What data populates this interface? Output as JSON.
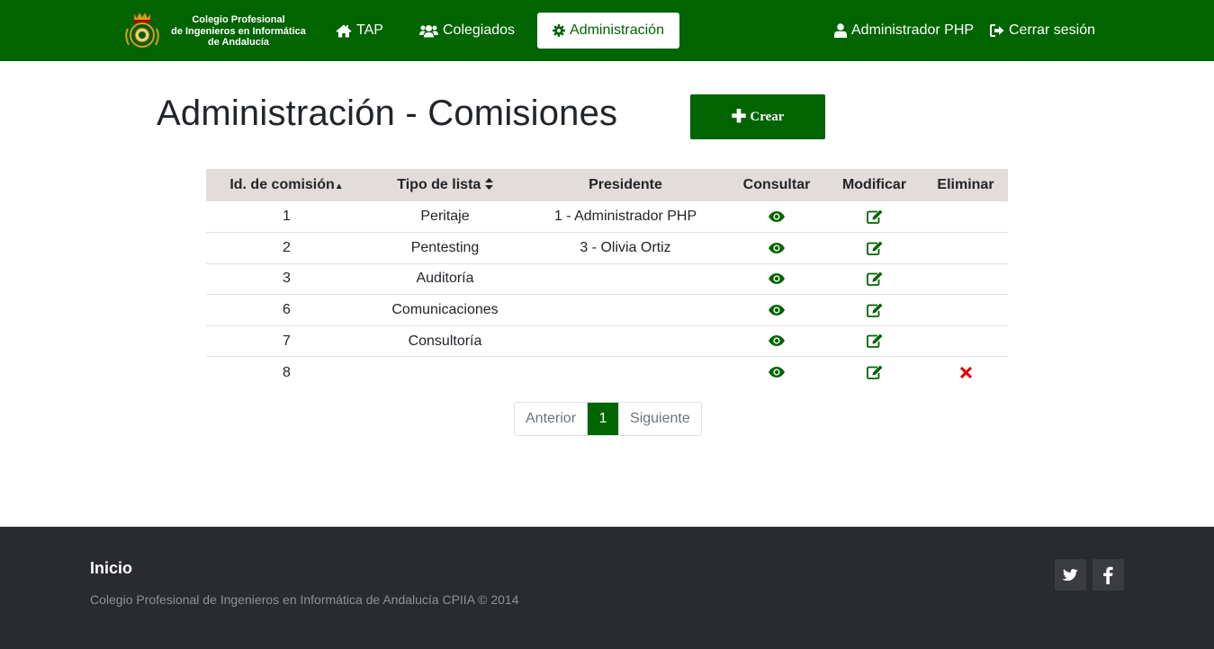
{
  "navbar": {
    "brand_line1": "Colegio Profesional",
    "brand_line2": "de Ingenieros en Informática",
    "brand_line3": "de Andalucía",
    "links": [
      {
        "label": "TAP",
        "icon": "home-icon"
      },
      {
        "label": "Colegiados",
        "icon": "users-icon"
      },
      {
        "label": "Administración",
        "icon": "gear-icon",
        "active": true
      }
    ],
    "user_label": "Administrador PHP",
    "logout_label": "Cerrar sesión"
  },
  "main": {
    "title": "Administración - Comisiones",
    "create_label": "Crear",
    "table": {
      "headers": [
        "Id. de comisión",
        "Tipo de lista",
        "Presidente",
        "Consultar",
        "Modificar",
        "Eliminar"
      ],
      "rows": [
        {
          "id": "1",
          "tipo": "Peritaje",
          "presidente": "1 - Administrador PHP",
          "deletable": false
        },
        {
          "id": "2",
          "tipo": "Pentesting",
          "presidente": "3 - Olivia Ortiz",
          "deletable": false
        },
        {
          "id": "3",
          "tipo": "Auditoría",
          "presidente": "",
          "deletable": false
        },
        {
          "id": "6",
          "tipo": "Comunicaciones",
          "presidente": "",
          "deletable": false
        },
        {
          "id": "7",
          "tipo": "Consultoría",
          "presidente": "",
          "deletable": false
        },
        {
          "id": "8",
          "tipo": "",
          "presidente": "",
          "deletable": true
        }
      ]
    },
    "pagination": {
      "prev": "Anterior",
      "current": "1",
      "next": "Siguiente"
    }
  },
  "footer": {
    "home_label": "Inicio",
    "copyright": "Colegio Profesional de Ingenieros en Informática de Andalucía CPIIA © 2014",
    "social": [
      "twitter-icon",
      "facebook-icon"
    ]
  },
  "colors": {
    "brand": "#006400",
    "delete": "#e00000",
    "footer_bg": "#292b2e",
    "header_row": "#e2dcda"
  }
}
